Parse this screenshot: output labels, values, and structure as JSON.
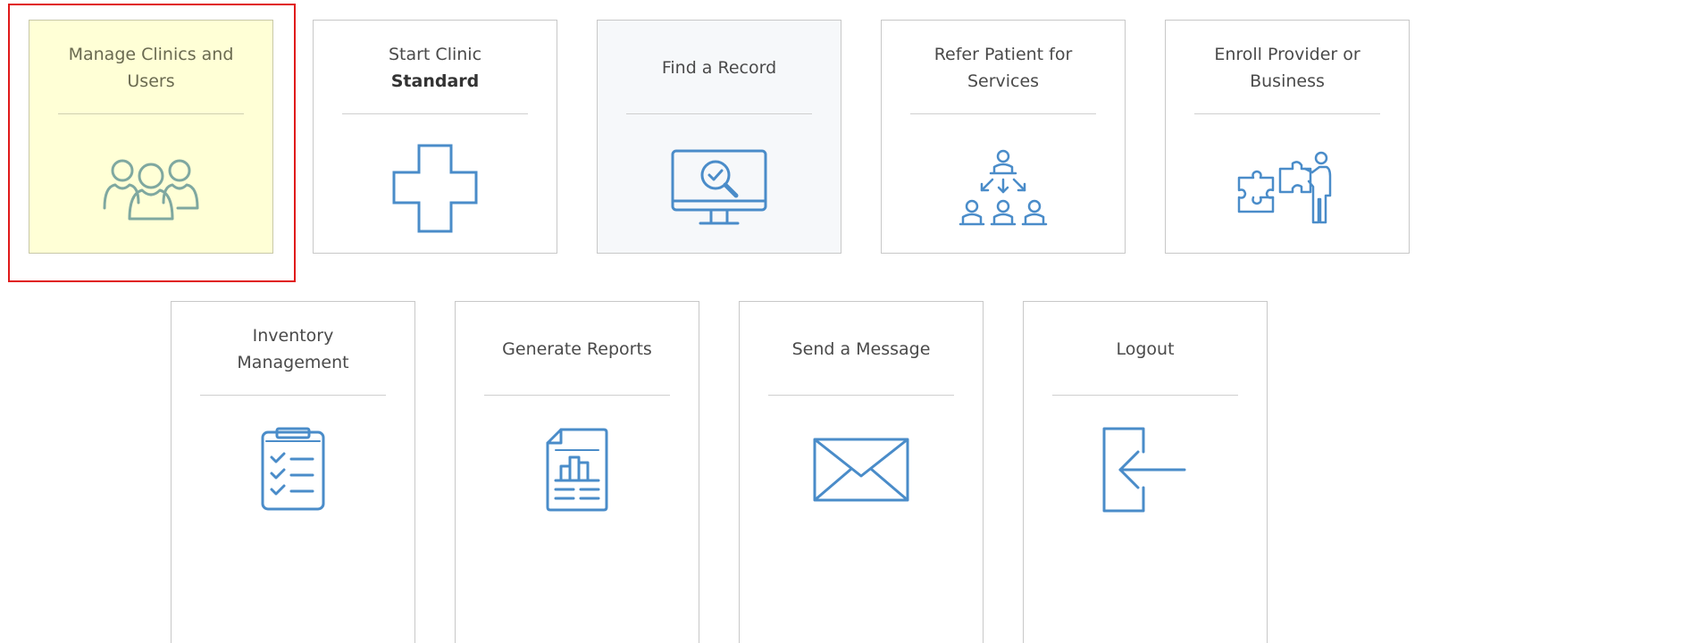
{
  "colors": {
    "icon_blue": "#4a8cc9",
    "icon_selected": "#7fa8a0",
    "selected_bg": "#ffffd6",
    "highlight_border": "#e01a1a"
  },
  "tiles": [
    {
      "line1": "Manage Clinics and",
      "line2": "Users",
      "icon": "users-icon"
    },
    {
      "line1": "Start Clinic",
      "line2": "Standard",
      "icon": "medical-cross-icon"
    },
    {
      "line1": "Find a Record",
      "icon": "monitor-search-icon"
    },
    {
      "line1": "Refer Patient for",
      "line2": "Services",
      "icon": "referral-hierarchy-icon"
    },
    {
      "line1": "Enroll Provider or",
      "line2": "Business",
      "icon": "puzzle-person-icon"
    },
    {
      "line1": "Inventory",
      "line2": "Management",
      "icon": "checklist-clipboard-icon"
    },
    {
      "line1": "Generate Reports",
      "icon": "report-document-icon"
    },
    {
      "line1": "Send a Message",
      "icon": "envelope-icon"
    },
    {
      "line1": "Logout",
      "icon": "logout-icon"
    }
  ]
}
